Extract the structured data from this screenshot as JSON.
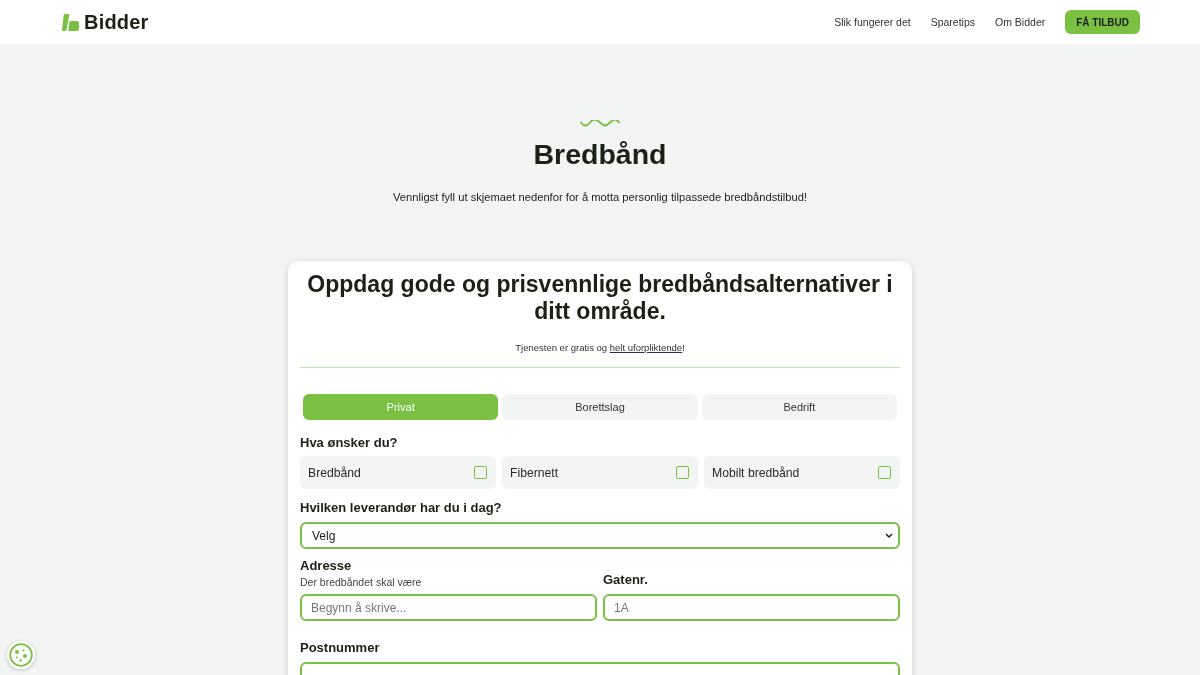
{
  "header": {
    "logo": "Bidder",
    "nav": [
      {
        "label": "Slik fungerer det"
      },
      {
        "label": "Sparetips"
      },
      {
        "label": "Om Bidder"
      }
    ],
    "cta": "FÅ TILBUD"
  },
  "hero": {
    "title": "Bredbånd",
    "subtitle": "Vennligst fyll ut skjemaet nedenfor for å motta personlig tilpassede bredbåndstilbud!"
  },
  "form_card": {
    "heading": "Oppdag gode og prisvennlige bredbåndsalternativer i ditt område.",
    "note": {
      "text": "Tjenesten er gratis og",
      "link": "helt uforpliktende",
      "end": "!"
    },
    "tabs": [
      {
        "label": "Privat",
        "selected": true
      },
      {
        "label": "Borettslag",
        "selected": false
      },
      {
        "label": "Bedrift",
        "selected": false
      }
    ],
    "wishes": {
      "label": "Hva ønsker du?",
      "options": [
        {
          "label": "Bredbånd",
          "checked": false
        },
        {
          "label": "Fibernett",
          "checked": false
        },
        {
          "label": "Mobilt bredbånd",
          "checked": false
        }
      ]
    },
    "provider": {
      "label": "Hvilken leverandør har du i dag?",
      "value": "Velg"
    },
    "address": {
      "label": "Adresse",
      "hint": "Der bredbåndet skal være",
      "placeholder": "Begynn å skrive..."
    },
    "street_number": {
      "label": "Gatenr.",
      "placeholder": "1A"
    },
    "postal_code": {
      "label": "Postnummer"
    }
  }
}
